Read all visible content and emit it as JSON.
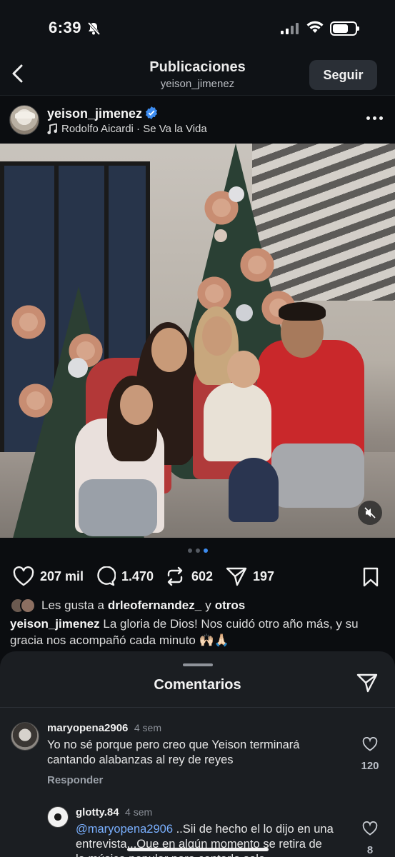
{
  "status_bar": {
    "time": "6:39",
    "battery_level": 0.7
  },
  "header": {
    "title": "Publicaciones",
    "subtitle": "yeison_jimenez",
    "follow_label": "Seguir"
  },
  "post": {
    "username": "yeison_jimenez",
    "music": "Rodolfo Aicardi · Se Va la Vida",
    "carousel": {
      "count": 3,
      "active": 3
    },
    "likes_count": "207 mil",
    "comments_count": "1.470",
    "reposts_count": "602",
    "shares_count": "197",
    "liked_by_prefix": "Les gusta a",
    "liked_by_user": "drleofernandez_",
    "liked_by_and": "y",
    "liked_by_others": "otros",
    "caption_user": "yeison_jimenez",
    "caption_text": "La gloria de Dios! Nos cuidó otro año más, y su gracia nos acompañó cada minuto 🙌🏻🙏🏻"
  },
  "comments_sheet": {
    "title": "Comentarios",
    "comments": [
      {
        "user": "maryopena2906",
        "time": "4 sem",
        "text": "Yo no sé porque pero creo que Yeison  terminará cantando alabanzas al rey de reyes",
        "reply_label": "Responder",
        "likes": "120"
      },
      {
        "user": "glotty.84",
        "time": "4 sem",
        "mention": "@maryopena2906",
        "text": " ..Sii de hecho el lo dijo en una entrevista...Que en algún momento se retira de la música popular para cantarle solo",
        "likes": "8"
      }
    ]
  },
  "icons": {
    "back": "chevron-left-icon",
    "verified": "verified-badge-icon",
    "music": "music-note-icon",
    "more": "more-dots-icon",
    "mute": "muted-speaker-icon",
    "like": "heart-icon",
    "comment": "comment-bubble-icon",
    "repost": "repost-icon",
    "share": "paper-plane-icon",
    "save": "bookmark-icon"
  },
  "colors": {
    "accent": "#3d8cf0",
    "background": "#0b0d10",
    "sheet": "#1b1e22"
  }
}
